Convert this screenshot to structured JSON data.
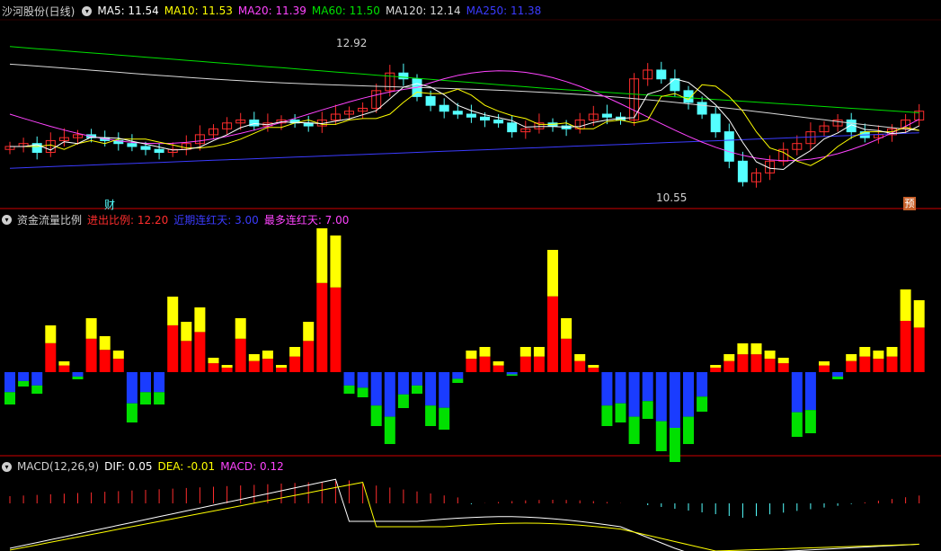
{
  "colors": {
    "bg": "#000000",
    "up": "#ff2d2d",
    "down": "#54ffff",
    "grid": "#8a0000",
    "ma5": "#ffffff",
    "ma10": "#ffff00",
    "ma20": "#ff44ff",
    "ma60": "#00e000",
    "ma120": "#d9d9d9",
    "ma250": "#3b3bff",
    "bar_red": "#ff0000",
    "bar_yellow": "#ffff00",
    "bar_blue": "#1a3cff",
    "bar_green": "#00e000"
  },
  "panel1": {
    "title": "沙河股份(日线)",
    "toggle_icon": "chevron-down-icon",
    "ma": [
      {
        "label": "MA5: 11.54",
        "color": "#ffffff"
      },
      {
        "label": "MA10: 11.53",
        "color": "#ffff00"
      },
      {
        "label": "MA20: 11.39",
        "color": "#ff44ff"
      },
      {
        "label": "MA60: 11.50",
        "color": "#00e000"
      },
      {
        "label": "MA120: 12.14",
        "color": "#d9d9d9"
      },
      {
        "label": "MA250: 11.38",
        "color": "#3b3bff"
      }
    ],
    "high_label": "12.92",
    "low_label": "10.55",
    "marker_cai": "财",
    "marker_yu": "预"
  },
  "panel2": {
    "title": "资金流量比例",
    "toggle_icon": "chevron-down-icon",
    "items": [
      {
        "label": "进出比例: 12.20",
        "color": "#ff2d2d"
      },
      {
        "label": "近期连红天: 3.00",
        "color": "#3b3bff"
      },
      {
        "label": "最多连红天: 7.00",
        "color": "#ff44ff"
      }
    ]
  },
  "panel3": {
    "title": "MACD(12,26,9)",
    "toggle_icon": "chevron-down-icon",
    "items": [
      {
        "label": "DIF: 0.05",
        "color": "#ffffff"
      },
      {
        "label": "DEA: -0.01",
        "color": "#ffff00"
      },
      {
        "label": "MACD: 0.12",
        "color": "#ff44ff"
      }
    ]
  },
  "chart_data": [
    {
      "type": "candlestick",
      "title": "沙河股份(日线)",
      "count": 68,
      "high": 12.92,
      "low": 10.55,
      "series": [
        {
          "name": "MA5",
          "value": 11.54
        },
        {
          "name": "MA10",
          "value": 11.53
        },
        {
          "name": "MA20",
          "value": 11.39
        },
        {
          "name": "MA60",
          "value": 11.5
        },
        {
          "name": "MA120",
          "value": 12.14
        },
        {
          "name": "MA250",
          "value": 11.38
        }
      ]
    },
    {
      "type": "bar",
      "title": "资金流量比例",
      "series": [
        {
          "name": "进出比例",
          "value": 12.2
        },
        {
          "name": "近期连红天",
          "value": 3.0
        },
        {
          "name": "最多连红天",
          "value": 7.0
        }
      ]
    },
    {
      "type": "bar",
      "title": "MACD(12,26,9)",
      "series": [
        {
          "name": "DIF",
          "value": 0.05
        },
        {
          "name": "DEA",
          "value": -0.01
        },
        {
          "name": "MACD",
          "value": 0.12
        }
      ]
    }
  ]
}
